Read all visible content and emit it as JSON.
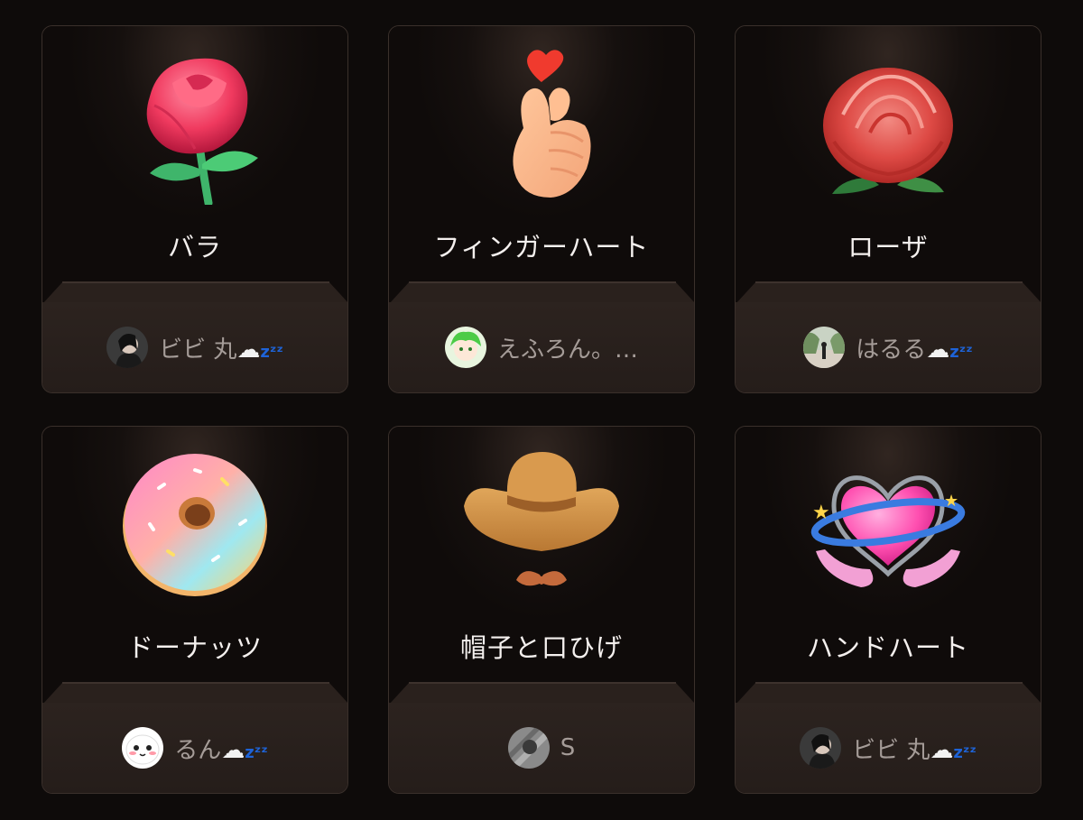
{
  "gifts": [
    {
      "name": "バラ",
      "sender": "ビビ 丸",
      "suffix": "zzz",
      "icon": "rose-icon",
      "avatar": "avatar-photo-dark"
    },
    {
      "name": "フィンガーハート",
      "sender": "えふろん。…",
      "suffix": "",
      "icon": "finger-heart-icon",
      "avatar": "avatar-green-character"
    },
    {
      "name": "ローザ",
      "sender": "はるる",
      "suffix": "zzz",
      "icon": "realistic-rose-icon",
      "avatar": "avatar-photo-outdoor"
    },
    {
      "name": "ドーナッツ",
      "sender": "るん",
      "suffix": "zzz",
      "icon": "donut-icon",
      "avatar": "avatar-white-face"
    },
    {
      "name": "帽子と口ひげ",
      "sender": "S",
      "suffix": "",
      "icon": "hat-and-mustache-icon",
      "avatar": "avatar-photo-grey"
    },
    {
      "name": "ハンドハート",
      "sender": "ビビ 丸",
      "suffix": "zzz",
      "icon": "hand-heart-icon",
      "avatar": "avatar-photo-dark"
    }
  ],
  "colors": {
    "background": "#0e0b0a",
    "footer": "#2c231f",
    "zzz": "#1e63d8"
  }
}
